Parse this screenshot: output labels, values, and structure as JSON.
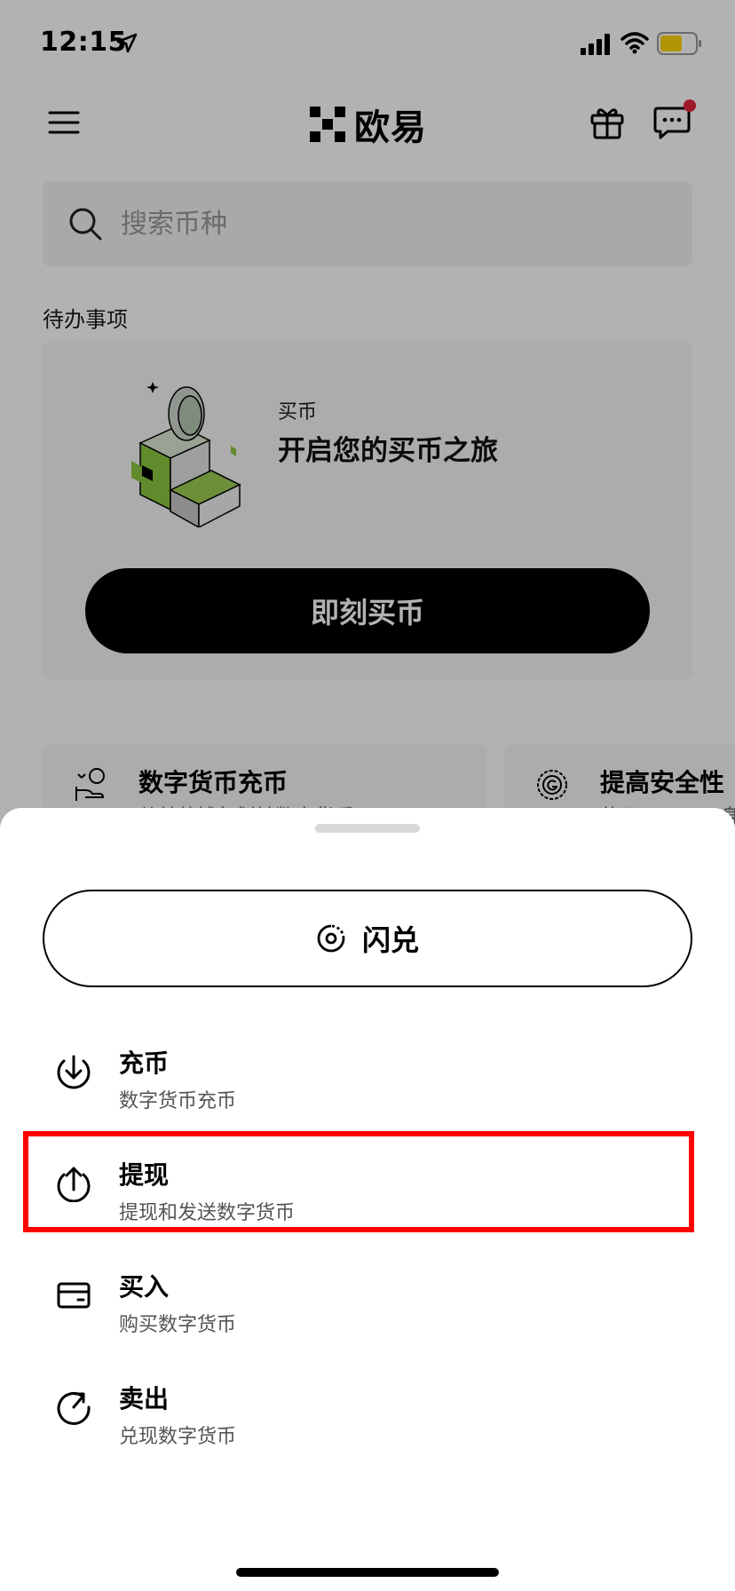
{
  "status_bar": {
    "time": "12:15"
  },
  "header": {
    "app_name": "欧易"
  },
  "search": {
    "placeholder": "搜索币种"
  },
  "todo": {
    "section_title": "待办事项",
    "card_small": "买币",
    "card_title": "开启您的买币之旅",
    "button_label": "即刻买币"
  },
  "tasks": [
    {
      "title": "数字货币充币",
      "subtitle": "从其他钱包划转数字货币"
    },
    {
      "title": "提高安全性",
      "subtitle": "使用 Google 身"
    }
  ],
  "sheet": {
    "convert_label": "闪兑",
    "actions": [
      {
        "title": "充币",
        "subtitle": "数字货币充币",
        "icon": "download-icon"
      },
      {
        "title": "提现",
        "subtitle": "提现和发送数字货币",
        "icon": "upload-icon"
      },
      {
        "title": "买入",
        "subtitle": "购买数字货币",
        "icon": "card-icon"
      },
      {
        "title": "卖出",
        "subtitle": "兑现数字货币",
        "icon": "sell-icon"
      }
    ]
  },
  "highlighted_action": "提现",
  "colors": {
    "highlight": "#ff0000",
    "notification_dot": "#e5243b",
    "accent_green": "#8cc63f"
  }
}
